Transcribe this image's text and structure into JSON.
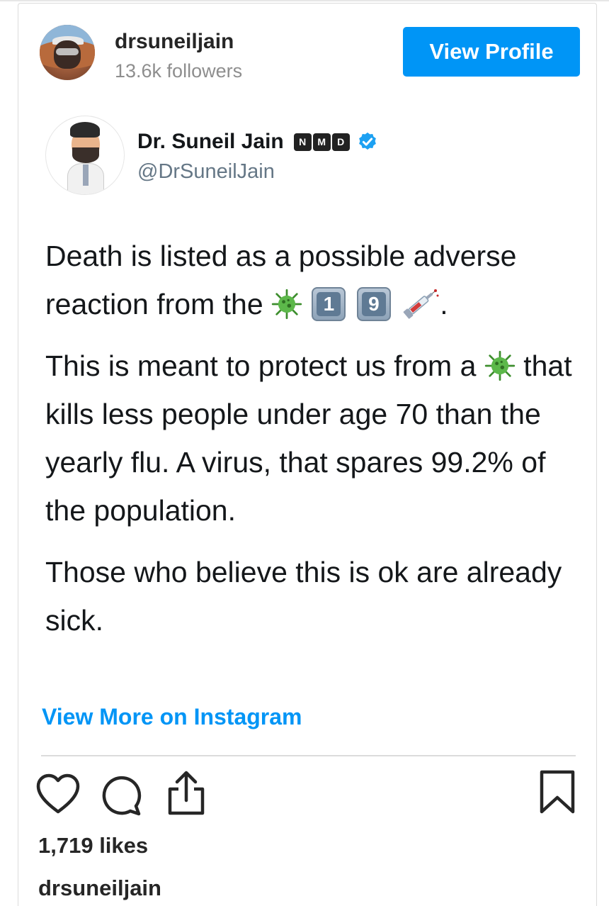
{
  "header": {
    "username": "drsuneiljain",
    "followers": "13.6k followers",
    "view_profile_label": "View Profile"
  },
  "tweet": {
    "name": "Dr. Suneil Jain",
    "badges": [
      "N",
      "M",
      "D"
    ],
    "handle": "@DrSuneilJain",
    "paragraphs": {
      "p1_text": "Death is listed as a possible adverse reaction from the",
      "p1_keycaps": [
        "1",
        "9"
      ],
      "p1_end": ".",
      "p2_text_a": "This is meant to protect us from a",
      "p2_text_b": "that kills less people under age 70 than the yearly flu. A virus, that spares 99.2% of the population.",
      "p3_text": "Those who believe this is ok are already sick."
    }
  },
  "footer": {
    "more_link": "View More on Instagram",
    "likes": "1,719 likes",
    "caption_user": "drsuneiljain"
  },
  "colors": {
    "accent": "#0095f6",
    "text": "#262626",
    "muted": "#8e8e8e",
    "twitter_verified": "#1da1f2",
    "virus_green": "#4caf3a"
  },
  "icons": [
    "heart-icon",
    "comment-icon",
    "share-icon",
    "bookmark-icon",
    "verified-icon",
    "virus-emoji",
    "syringe-emoji"
  ]
}
